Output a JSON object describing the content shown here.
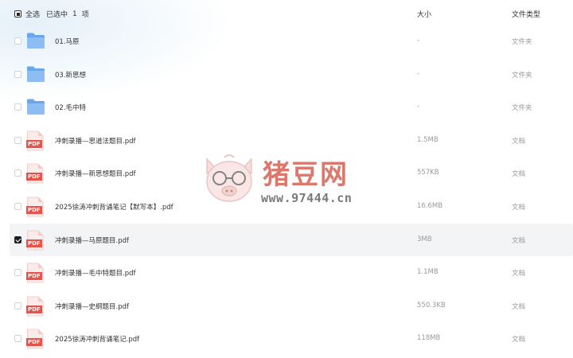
{
  "header": {
    "select_all": "全选",
    "selected_prefix": "已选中",
    "selected_count": "1",
    "selected_suffix": "项",
    "col_size": "大小",
    "col_type": "文件类型"
  },
  "files": [
    {
      "name": "01.马原",
      "size": "-",
      "type": "文件夹",
      "icon": "folder-icon",
      "checked": false
    },
    {
      "name": "03.新思想",
      "size": "-",
      "type": "文件夹",
      "icon": "folder-icon",
      "checked": false
    },
    {
      "name": "02.毛中特",
      "size": "-",
      "type": "文件夹",
      "icon": "folder-icon",
      "checked": false
    },
    {
      "name": "冲刺录播—思道法题目.pdf",
      "size": "1.5MB",
      "type": "文档",
      "icon": "pdf-icon",
      "checked": false
    },
    {
      "name": "冲刺录播—新思想题目.pdf",
      "size": "557KB",
      "type": "文档",
      "icon": "pdf-icon",
      "checked": false
    },
    {
      "name": "2025徐涛冲刺背诵笔记【默写本】.pdf",
      "size": "16.6MB",
      "type": "文档",
      "icon": "pdf-icon",
      "checked": false
    },
    {
      "name": "冲刺录播—马原题目.pdf",
      "size": "3MB",
      "type": "文档",
      "icon": "pdf-icon",
      "checked": true
    },
    {
      "name": "冲刺录播—毛中特题目.pdf",
      "size": "1.1MB",
      "type": "文档",
      "icon": "pdf-icon",
      "checked": false
    },
    {
      "name": "冲刺录播—史纲题目.pdf",
      "size": "550.3KB",
      "type": "文档",
      "icon": "pdf-icon",
      "checked": false
    },
    {
      "name": "2025徐涛冲刺背诵笔记.pdf",
      "size": "118MB",
      "type": "文档",
      "icon": "pdf-icon",
      "checked": false
    }
  ],
  "pdf_label": "PDF",
  "watermark": {
    "brand": "猪豆网",
    "url": "www.97444.cn"
  },
  "colors": {
    "folder": "#6aa6ea",
    "pdf_red": "#e5534b",
    "checkbox_checked": "#1f1f1f",
    "selected_row": "#f3f4f6"
  }
}
